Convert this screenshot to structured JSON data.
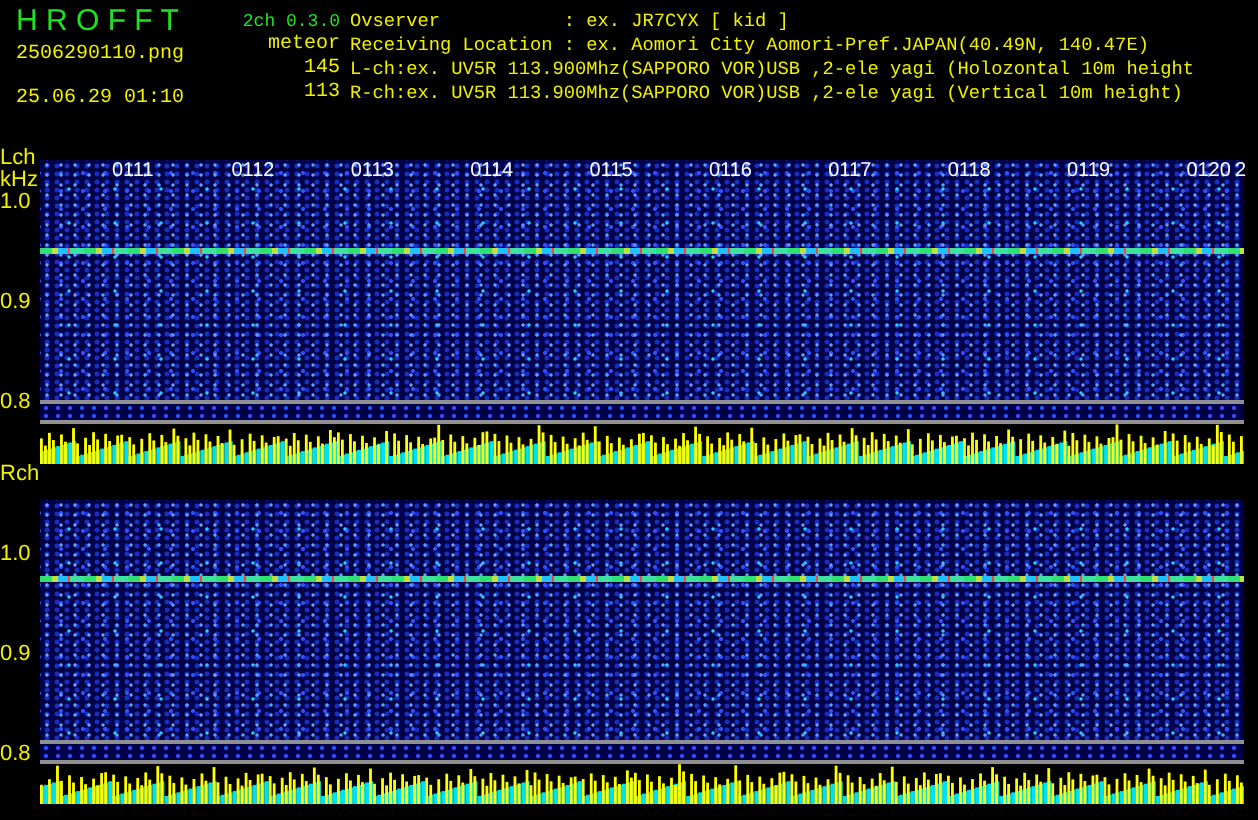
{
  "header": {
    "app_name": "H R O F F T",
    "file_name": "2506290110.png",
    "timestamp": "25.06.29 01:10",
    "version": "2ch 0.3.0",
    "mode": "meteor",
    "counts": [
      "145",
      "113"
    ],
    "info_lines": [
      "Ovserver           : ex. JR7CYX [ kid ]",
      "Receiving Location : ex. Aomori City Aomori-Pref.JAPAN(40.49N, 140.47E)",
      "L-ch:ex. UV5R 113.900Mhz(SAPPORO VOR)USB ,2-ele yagi (Holozontal 10m height",
      "R-ch:ex. UV5R 113.900Mhz(SAPPORO VOR)USB ,2-ele yagi (Vertical 10m height)"
    ]
  },
  "channels": [
    {
      "label": "Lch",
      "unit": "kHz",
      "axis_ticks": [
        "1.0",
        "0.9",
        "0.8"
      ],
      "time_labels": [
        "0111",
        "0112",
        "0113",
        "0114",
        "0115",
        "0116",
        "0117",
        "0118",
        "0119",
        "0120",
        "2"
      ]
    },
    {
      "label": "Rch",
      "axis_ticks": [
        "1.0",
        "0.9",
        "0.8"
      ]
    }
  ]
}
